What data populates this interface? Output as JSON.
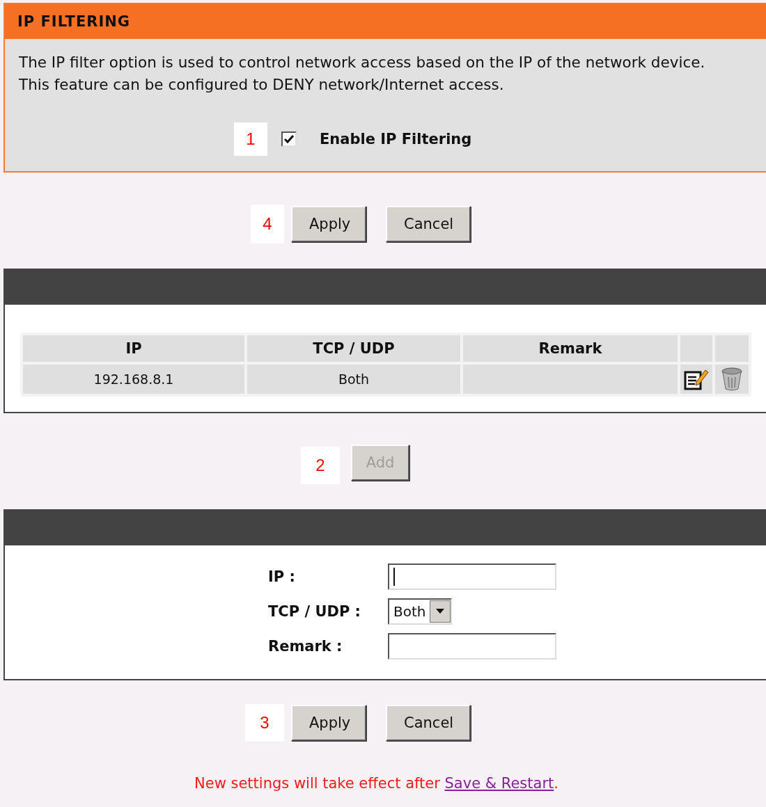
{
  "section": {
    "title": "IP FILTERING",
    "description": [
      "The IP filter option is used to control network access based on the IP of the network device.",
      "This feature can be configured to DENY network/Internet access."
    ],
    "enable": {
      "marker": "1",
      "label": "Enable IP Filtering",
      "checked": true
    }
  },
  "top_actions": {
    "marker": "4",
    "buttons": [
      {
        "label": "Apply",
        "disabled": false
      },
      {
        "label": "Cancel",
        "disabled": false
      }
    ]
  },
  "rules_table": {
    "columns": [
      "IP",
      "TCP / UDP",
      "Remark"
    ],
    "rows": [
      {
        "ip": "192.168.8.1",
        "protocol": "Both"
      }
    ]
  },
  "add": {
    "marker": "2",
    "label": "Add",
    "disabled": true
  },
  "form": {
    "fields": [
      {
        "kind": "text",
        "label": "IP :",
        "focused": true
      },
      {
        "kind": "select",
        "label": "TCP / UDP :",
        "value": "Both"
      },
      {
        "kind": "text",
        "label": "Remark :",
        "focused": false
      }
    ]
  },
  "bottom_actions": {
    "marker": "3",
    "buttons": [
      {
        "label": "Apply",
        "disabled": false
      },
      {
        "label": "Cancel",
        "disabled": false
      }
    ]
  },
  "notice": {
    "text": "New settings will take effect after",
    "link": "Save & Restart",
    "end": "."
  }
}
